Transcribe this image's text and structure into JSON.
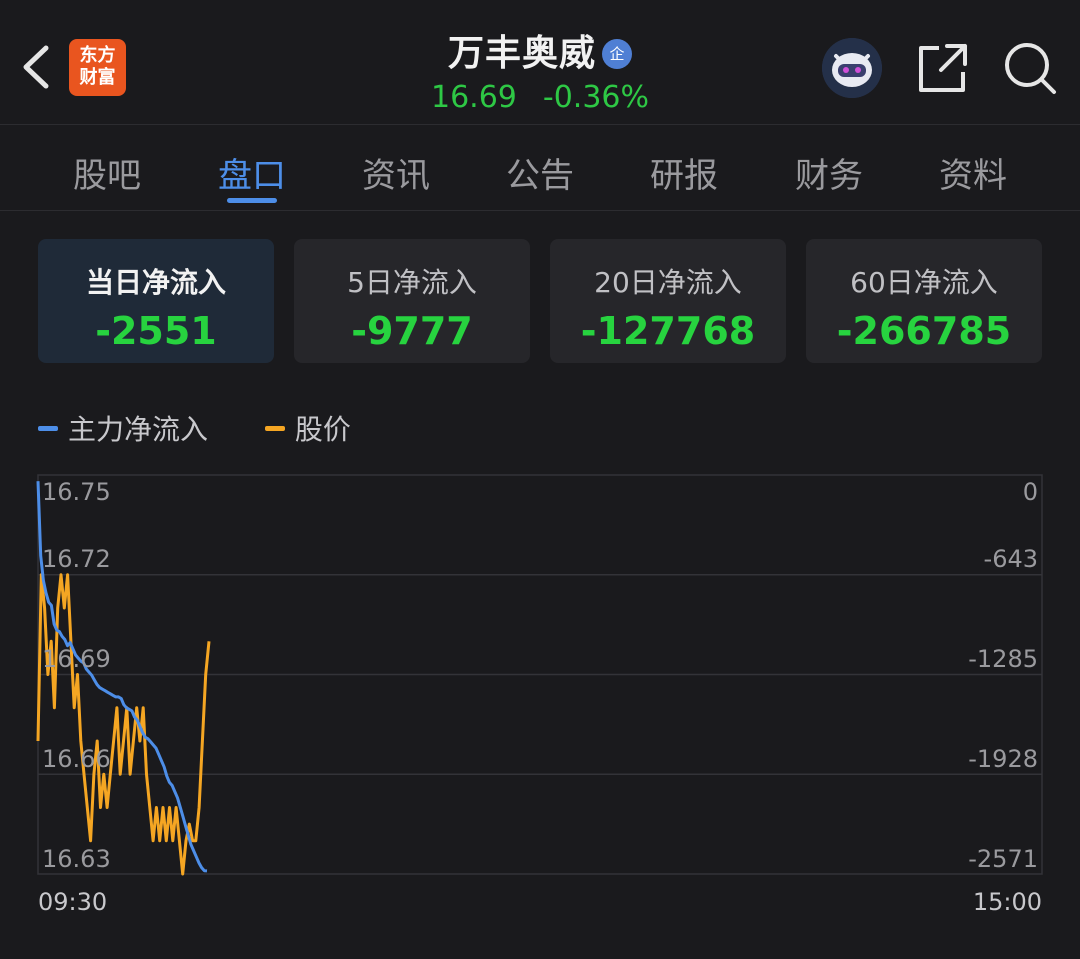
{
  "header": {
    "logo_line1": "东方",
    "logo_line2": "财富",
    "stock_name": "万丰奥威",
    "badge": "企",
    "price": "16.69",
    "change_pct": "-0.36%",
    "icons": [
      "back-chevron-icon",
      "robot-avatar-icon",
      "share-icon",
      "search-icon"
    ]
  },
  "tabs": [
    {
      "label": "股吧",
      "active": false
    },
    {
      "label": "盘口",
      "active": true
    },
    {
      "label": "资讯",
      "active": false
    },
    {
      "label": "公告",
      "active": false
    },
    {
      "label": "研报",
      "active": false
    },
    {
      "label": "财务",
      "active": false
    },
    {
      "label": "资料",
      "active": false
    }
  ],
  "cards": [
    {
      "label": "当日净流入",
      "value": "-2551",
      "selected": true
    },
    {
      "label": "5日净流入",
      "value": "-9777",
      "selected": false
    },
    {
      "label": "20日净流入",
      "value": "-127768",
      "selected": false
    },
    {
      "label": "60日净流入",
      "value": "-266785",
      "selected": false
    }
  ],
  "legend": [
    {
      "label": "主力净流入",
      "color": "#4d8ee8"
    },
    {
      "label": "股价",
      "color": "#f5a623"
    }
  ],
  "colors": {
    "accent": "#4d8ee8",
    "up_green": "#27d33f",
    "price_line": "#f5a623",
    "flow_line": "#4d8ee8"
  },
  "chart_data": {
    "type": "line",
    "x_labels": [
      "09:30",
      "15:00"
    ],
    "y_left_ticks": [
      "16.75",
      "16.72",
      "16.69",
      "16.66",
      "16.63"
    ],
    "y_left_range": [
      16.63,
      16.75
    ],
    "y_right_ticks": [
      "0",
      "-643",
      "-1285",
      "-1928",
      "-2571"
    ],
    "y_right_range": [
      -2571,
      0
    ],
    "grid": true,
    "x_count": 240,
    "series": [
      {
        "name": "主力净流入",
        "axis": "right",
        "values": [
          -40,
          -520,
          -680,
          -760,
          -820,
          -840,
          -960,
          -1000,
          -1010,
          -1040,
          -1060,
          -1100,
          -1080,
          -1120,
          -1160,
          -1180,
          -1200,
          -1210,
          -1250,
          -1270,
          -1290,
          -1320,
          -1350,
          -1370,
          -1380,
          -1390,
          -1400,
          -1410,
          -1420,
          -1430,
          -1430,
          -1440,
          -1480,
          -1500,
          -1510,
          -1520,
          -1560,
          -1580,
          -1620,
          -1660,
          -1690,
          -1700,
          -1720,
          -1740,
          -1760,
          -1800,
          -1840,
          -1880,
          -1940,
          -1980,
          -2000,
          -2040,
          -2080,
          -2140,
          -2200,
          -2260,
          -2320,
          -2380,
          -2420,
          -2460,
          -2500,
          -2530,
          -2550,
          -2551
        ]
      },
      {
        "name": "股价",
        "axis": "left",
        "values": [
          16.67,
          16.72,
          16.71,
          16.69,
          16.7,
          16.68,
          16.71,
          16.72,
          16.71,
          16.72,
          16.7,
          16.68,
          16.69,
          16.67,
          16.66,
          16.65,
          16.64,
          16.66,
          16.67,
          16.65,
          16.66,
          16.65,
          16.66,
          16.67,
          16.68,
          16.66,
          16.67,
          16.68,
          16.66,
          16.67,
          16.68,
          16.67,
          16.68,
          16.66,
          16.65,
          16.64,
          16.65,
          16.64,
          16.65,
          16.64,
          16.65,
          16.64,
          16.65,
          16.64,
          16.63,
          16.64,
          16.645,
          16.64,
          16.64,
          16.65,
          16.67,
          16.69,
          16.7
        ]
      }
    ]
  }
}
